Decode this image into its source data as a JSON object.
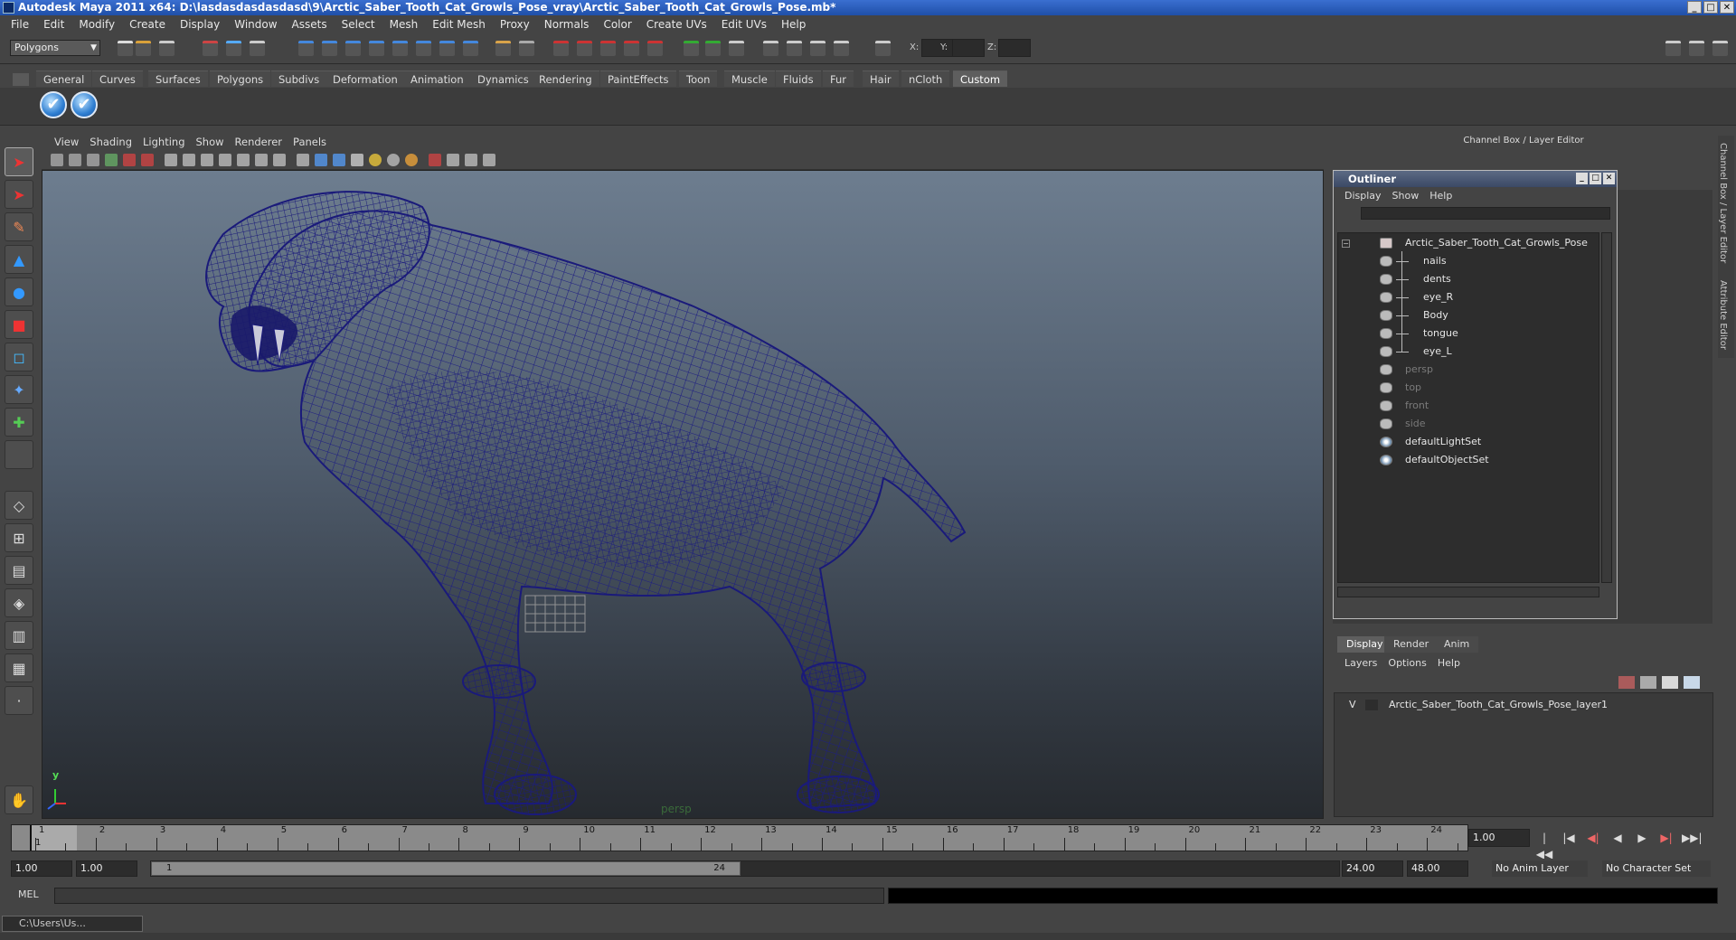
{
  "window": {
    "title": "Autodesk Maya 2011 x64: D:\\lasdasdasdasdasd\\9\\Arctic_Saber_Tooth_Cat_Growls_Pose_vray\\Arctic_Saber_Tooth_Cat_Growls_Pose.mb*",
    "controls": [
      "_",
      "□",
      "✕"
    ]
  },
  "menu": [
    "File",
    "Edit",
    "Modify",
    "Create",
    "Display",
    "Window",
    "Assets",
    "Select",
    "Mesh",
    "Edit Mesh",
    "Proxy",
    "Normals",
    "Color",
    "Create UVs",
    "Edit UVs",
    "Help"
  ],
  "status_line": {
    "menu_set": "Polygons",
    "coord_labels": [
      "X:",
      "Y:",
      "Z:"
    ]
  },
  "shelf": {
    "tabs": [
      "General",
      "Curves",
      "Surfaces",
      "Polygons",
      "Subdivs",
      "Deformation",
      "Animation",
      "Dynamics",
      "Rendering",
      "PaintEffects",
      "Toon",
      "Muscle",
      "Fluids",
      "Fur",
      "Hair",
      "nCloth",
      "Custom"
    ],
    "active_tab": "Custom",
    "buttons": [
      "check-icon",
      "check-icon"
    ]
  },
  "viewport": {
    "menu": [
      "View",
      "Shading",
      "Lighting",
      "Show",
      "Renderer",
      "Panels"
    ],
    "camera": "persp",
    "axis_y": "y",
    "wire_color": "#1a1a7a"
  },
  "channel_box": {
    "title": "Channel Box / Layer Editor",
    "side_tabs": [
      "Channel Box / Layer Editor",
      "Attribute Editor"
    ]
  },
  "outliner": {
    "title": "Outliner",
    "menu": [
      "Display",
      "Show",
      "Help"
    ],
    "items": [
      {
        "label": "Arctic_Saber_Tooth_Cat_Growls_Pose",
        "depth": 0,
        "dim": false,
        "type": "group"
      },
      {
        "label": "nails",
        "depth": 1,
        "dim": false,
        "type": "mesh"
      },
      {
        "label": "dents",
        "depth": 1,
        "dim": false,
        "type": "mesh"
      },
      {
        "label": "eye_R",
        "depth": 1,
        "dim": false,
        "type": "mesh"
      },
      {
        "label": "Body",
        "depth": 1,
        "dim": false,
        "type": "mesh"
      },
      {
        "label": "tongue",
        "depth": 1,
        "dim": false,
        "type": "mesh"
      },
      {
        "label": "eye_L",
        "depth": 1,
        "dim": false,
        "type": "mesh"
      },
      {
        "label": "persp",
        "depth": 0,
        "dim": true,
        "type": "camera"
      },
      {
        "label": "top",
        "depth": 0,
        "dim": true,
        "type": "camera"
      },
      {
        "label": "front",
        "depth": 0,
        "dim": true,
        "type": "camera"
      },
      {
        "label": "side",
        "depth": 0,
        "dim": true,
        "type": "camera"
      },
      {
        "label": "defaultLightSet",
        "depth": 0,
        "dim": false,
        "type": "set"
      },
      {
        "label": "defaultObjectSet",
        "depth": 0,
        "dim": false,
        "type": "set"
      }
    ]
  },
  "layer_editor": {
    "tabs": [
      "Display",
      "Render",
      "Anim"
    ],
    "active_tab": "Display",
    "menu": [
      "Layers",
      "Options",
      "Help"
    ],
    "layers": [
      {
        "visible": "V",
        "name": "Arctic_Saber_Tooth_Cat_Growls_Pose_layer1"
      }
    ]
  },
  "timeline": {
    "frames": [
      "1",
      "2",
      "3",
      "4",
      "5",
      "6",
      "7",
      "8",
      "9",
      "10",
      "11",
      "12",
      "13",
      "14",
      "15",
      "16",
      "17",
      "18",
      "19",
      "20",
      "21",
      "22",
      "23",
      "24"
    ],
    "current_frame_marker": "1",
    "current_frame": "1.00",
    "playback": [
      "|◀◀",
      "|◀",
      "◀|",
      "◀",
      "▶",
      "▶|",
      "▶▶|"
    ]
  },
  "range": {
    "start": "1.00",
    "playback_start": "1.00",
    "range_start_label": "1",
    "range_end_label": "24",
    "playback_end": "24.00",
    "end": "48.00",
    "anim_layer": "No Anim Layer",
    "character_set": "No Character Set"
  },
  "command_line": {
    "mode": "MEL"
  },
  "taskbar": {
    "item": "C:\\Users\\Us..."
  }
}
